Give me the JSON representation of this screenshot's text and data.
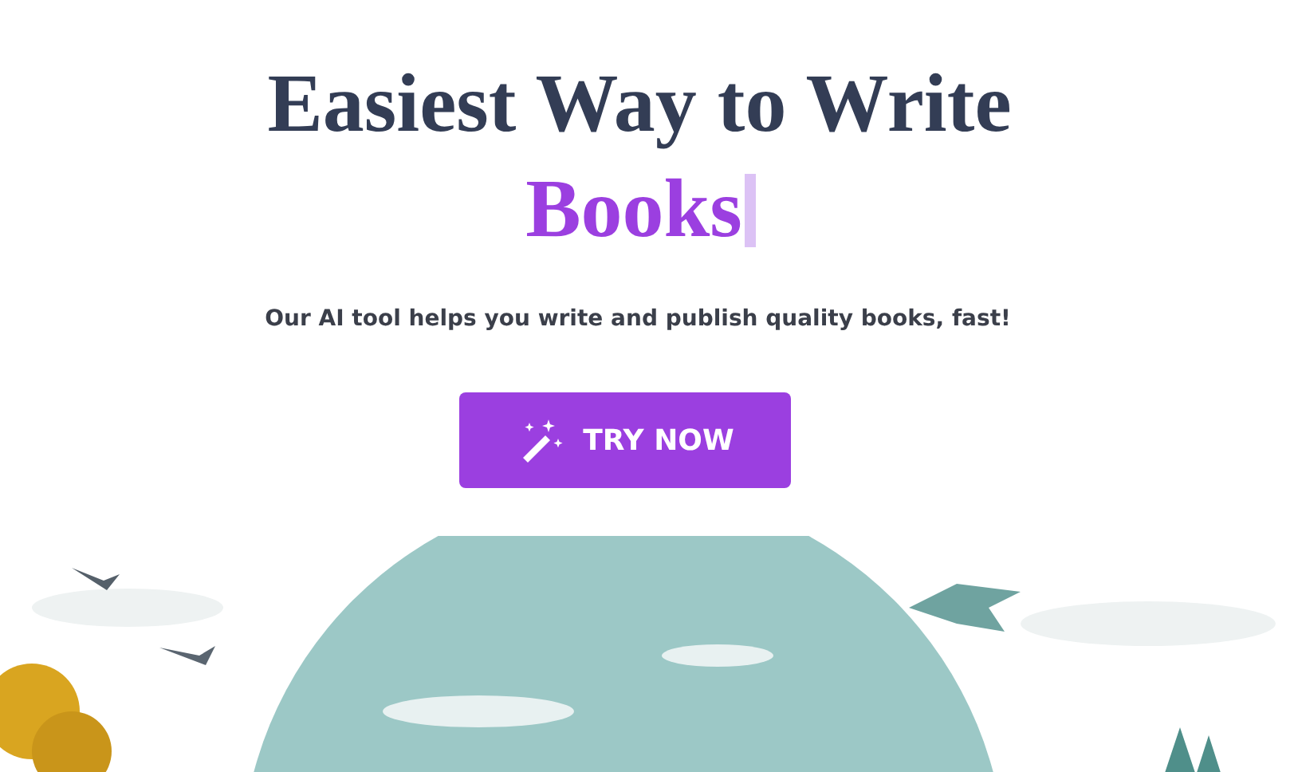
{
  "hero": {
    "title_line": "Easiest Way to Write",
    "highlight": "Books",
    "subtitle": "Our AI tool helps you write and publish quality books, fast!",
    "button": "TRY NOW"
  }
}
